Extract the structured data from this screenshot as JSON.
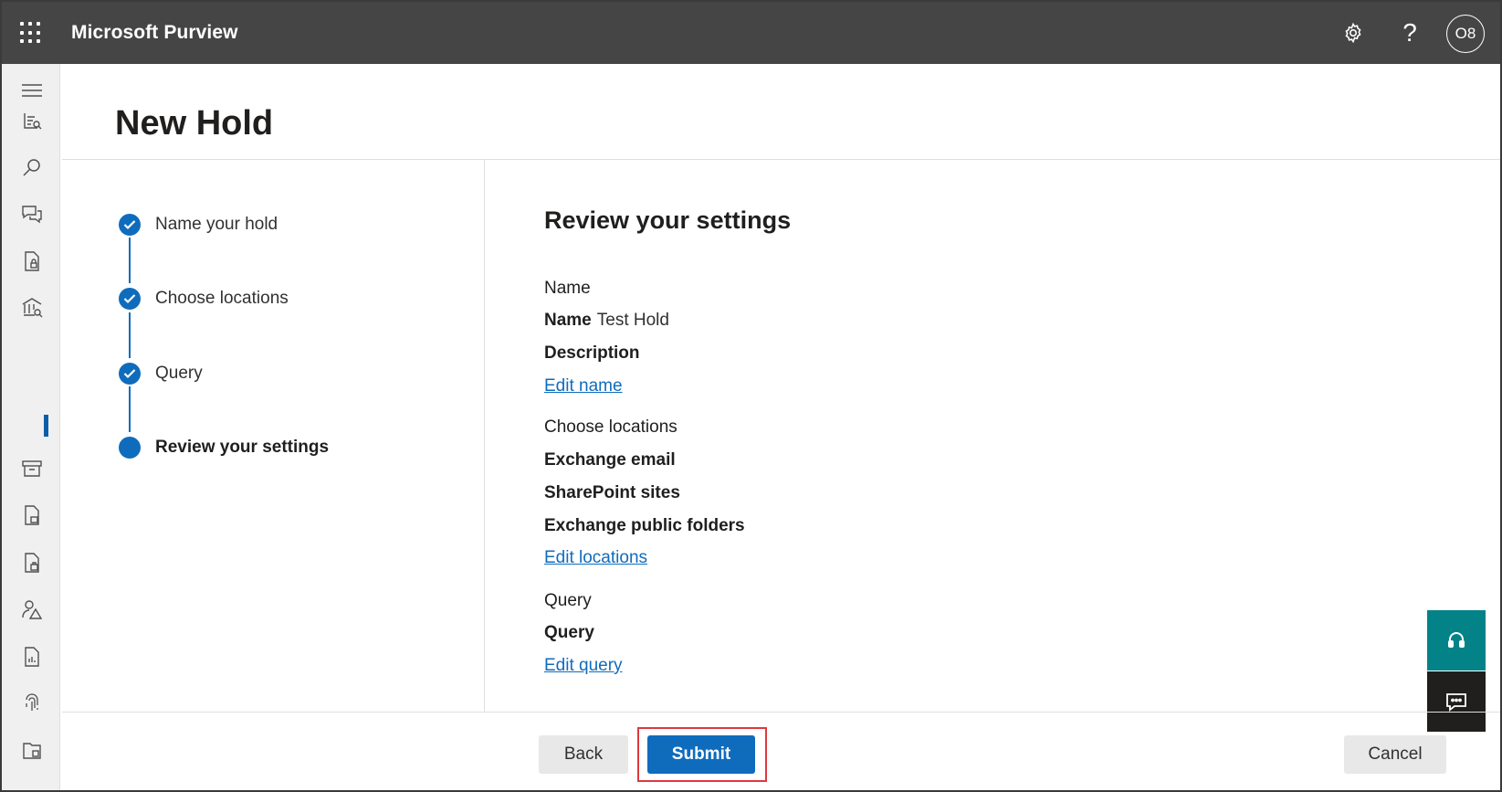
{
  "app": {
    "title": "Microsoft Purview",
    "user_initials": "O8"
  },
  "header": {
    "title": "New Hold"
  },
  "stepper": {
    "steps": [
      {
        "label": "Name your hold",
        "state": "completed"
      },
      {
        "label": "Choose locations",
        "state": "completed"
      },
      {
        "label": "Query",
        "state": "completed"
      },
      {
        "label": "Review your settings",
        "state": "current"
      }
    ]
  },
  "review": {
    "title": "Review your settings",
    "name_section": {
      "heading": "Name",
      "name_label": "Name",
      "name_value": "Test Hold",
      "description_label": "Description",
      "edit_link": "Edit name"
    },
    "locations_section": {
      "heading": "Choose locations",
      "items": [
        "Exchange email",
        "SharePoint sites",
        "Exchange public folders"
      ],
      "edit_link": "Edit locations"
    },
    "query_section": {
      "heading": "Query",
      "query_label": "Query",
      "edit_link": "Edit query"
    }
  },
  "footer": {
    "back_label": "Back",
    "submit_label": "Submit",
    "cancel_label": "Cancel"
  },
  "rail_icons": [
    "menu-icon",
    "reports-icon",
    "search-icon",
    "communication-icon",
    "policy-icon",
    "ediscovery-icon",
    "archive-icon",
    "compliance-icon",
    "retention-icon",
    "insider-risk-icon",
    "data-map-icon",
    "fingerprint-icon",
    "folder-icon"
  ],
  "colors": {
    "topbar": "#464545",
    "accent": "#0f6cbd",
    "highlight": "#e0383e",
    "help_button": "#038387"
  }
}
